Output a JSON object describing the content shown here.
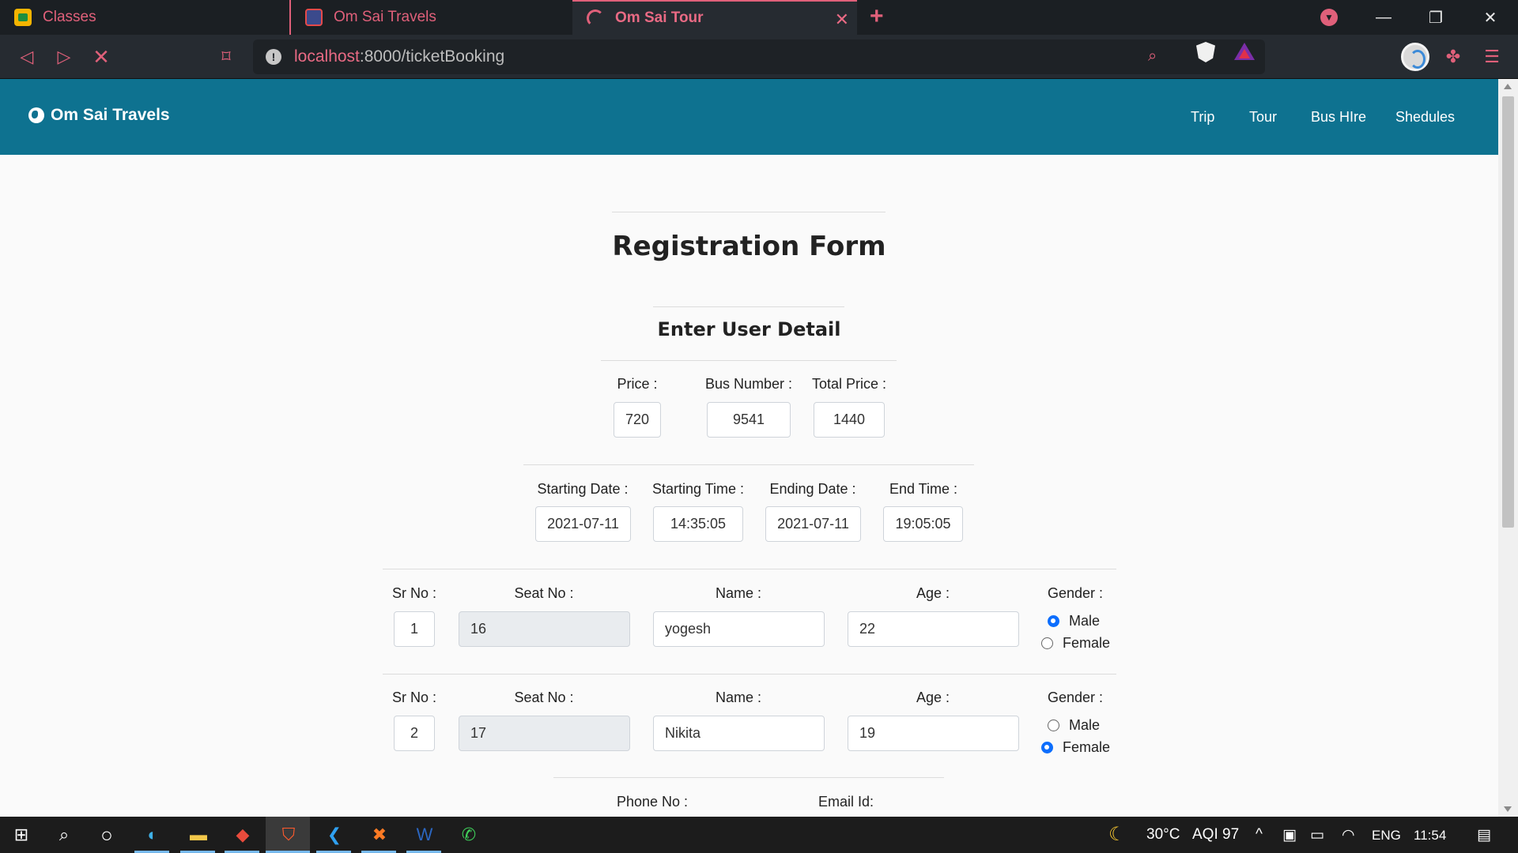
{
  "browser": {
    "tabs": [
      {
        "title": "Classes"
      },
      {
        "title": "Om Sai Travels"
      },
      {
        "title": "Om Sai Tour"
      }
    ],
    "url_host": "localhost",
    "url_path": ":8000/ticketBooking"
  },
  "site": {
    "brand": "Om Sai Travels",
    "nav": [
      "Trip",
      "Tour",
      "Bus HIre",
      "Shedules"
    ]
  },
  "form": {
    "title": "Registration Form",
    "subtitle": "Enter User Detail",
    "price_label": "Price :",
    "price": "720",
    "bus_number_label": "Bus Number :",
    "bus_number": "9541",
    "total_price_label": "Total Price :",
    "total_price": "1440",
    "starting_date_label": "Starting Date :",
    "starting_date": "2021-07-11",
    "starting_time_label": "Starting Time :",
    "starting_time": "14:35:05",
    "ending_date_label": "Ending Date :",
    "ending_date": "2021-07-11",
    "end_time_label": "End Time :",
    "end_time": "19:05:05",
    "passenger_labels": {
      "sr_no": "Sr No :",
      "seat_no": "Seat No :",
      "name": "Name :",
      "age": "Age :",
      "gender": "Gender :",
      "male": "Male",
      "female": "Female"
    },
    "passengers": [
      {
        "sr_no": "1",
        "seat_no": "16",
        "name": "yogesh",
        "age": "22",
        "gender": "Male"
      },
      {
        "sr_no": "2",
        "seat_no": "17",
        "name": "Nikita",
        "age": "19",
        "gender": "Female"
      }
    ],
    "phone_label": "Phone No :",
    "email_label": "Email Id:"
  },
  "taskbar": {
    "weather": "30°C",
    "aqi": "AQI 97",
    "language": "ENG",
    "time": "11:54"
  },
  "colors": {
    "header_bg": "#0e7290",
    "accent": "#e0607a",
    "page_bg": "#fafafa"
  }
}
